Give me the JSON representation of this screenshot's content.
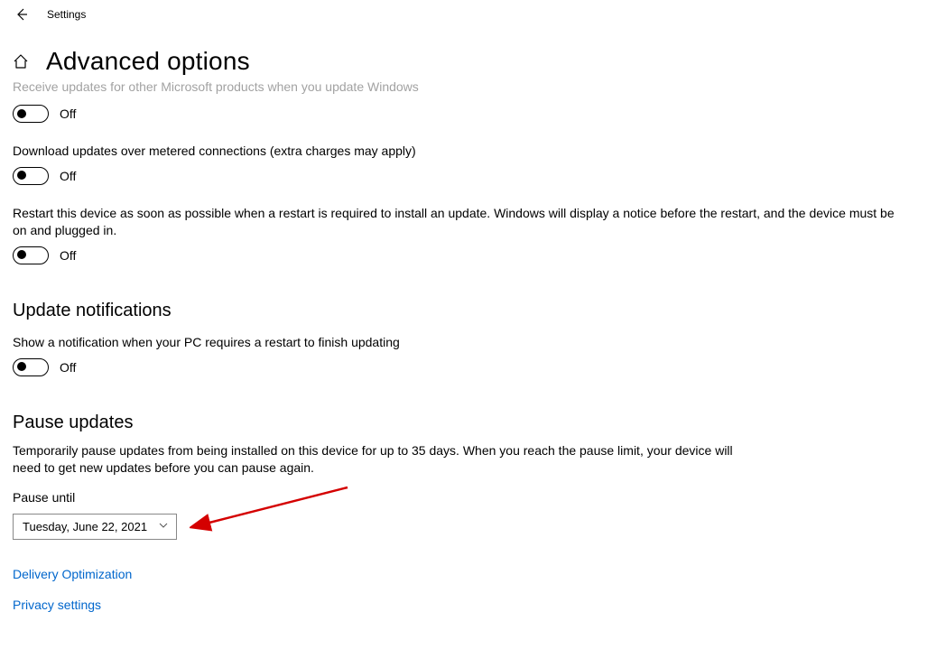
{
  "window": {
    "title": "Settings"
  },
  "page": {
    "title": "Advanced options"
  },
  "settings": {
    "receive_other_products": {
      "label": "Receive updates for other Microsoft products when you update Windows",
      "state": "Off"
    },
    "metered": {
      "label": "Download updates over metered connections (extra charges may apply)",
      "state": "Off"
    },
    "restart_asap": {
      "label": "Restart this device as soon as possible when a restart is required to install an update. Windows will display a notice before the restart, and the device must be on and plugged in.",
      "state": "Off"
    }
  },
  "notifications": {
    "heading": "Update notifications",
    "show_restart": {
      "label": "Show a notification when your PC requires a restart to finish updating",
      "state": "Off"
    }
  },
  "pause": {
    "heading": "Pause updates",
    "description": "Temporarily pause updates from being installed on this device for up to 35 days. When you reach the pause limit, your device will need to get new updates before you can pause again.",
    "field_label": "Pause until",
    "selected": "Tuesday, June 22, 2021"
  },
  "links": {
    "delivery": "Delivery Optimization",
    "privacy": "Privacy settings"
  }
}
